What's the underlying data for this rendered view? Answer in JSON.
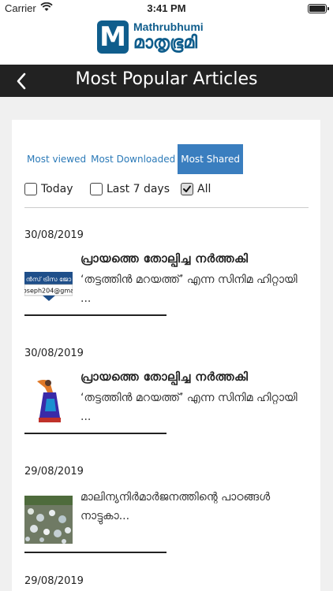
{
  "status": {
    "carrier": "Carrier",
    "time": "3:41 PM"
  },
  "brand": {
    "logo_letter": "M",
    "name_en": "Mathrubhumi",
    "name_ml": "മാതൃഭൂമി"
  },
  "nav": {
    "title": "Most Popular Articles"
  },
  "tabs": [
    {
      "label": "Most viewed",
      "active": false
    },
    {
      "label": "Most Downloaded",
      "active": false
    },
    {
      "label": "Most Shared",
      "active": true
    }
  ],
  "filters": [
    {
      "label": "Today",
      "checked": false
    },
    {
      "label": "Last 7 days",
      "checked": false
    },
    {
      "label": "All",
      "checked": true
    }
  ],
  "articles": [
    {
      "date": "30/08/2019",
      "title": "പ്രായത്തെ തോല്പിച്ച നർത്തകി",
      "description": "‘തട്ടത്തിൻ മറയത്ത്’ എന്ന സിനിമ ഹിറ്റായി ...",
      "thumb_text_1": "ൻസ് ട്രിസ ജോ",
      "thumb_text_2": "oseph204@gma"
    },
    {
      "date": "30/08/2019",
      "title": "പ്രായത്തെ തോല്പിച്ച നർത്തകി",
      "description": "‘തട്ടത്തിൻ മറയത്ത്’ എന്ന സിനിമ ഹിറ്റായി ..."
    },
    {
      "date": "29/08/2019",
      "title": "",
      "description": "മാലിന്യനിർമാർജനത്തിന്റെ പാഠങ്ങൾ നാട്ടുകാ..."
    },
    {
      "date": "29/08/2019"
    }
  ],
  "colors": {
    "brand_blue": "#0f5d8c",
    "tab_active_bg": "#3a7ebf",
    "tab_text": "#2b7ab8",
    "nav_bg": "#222222"
  }
}
